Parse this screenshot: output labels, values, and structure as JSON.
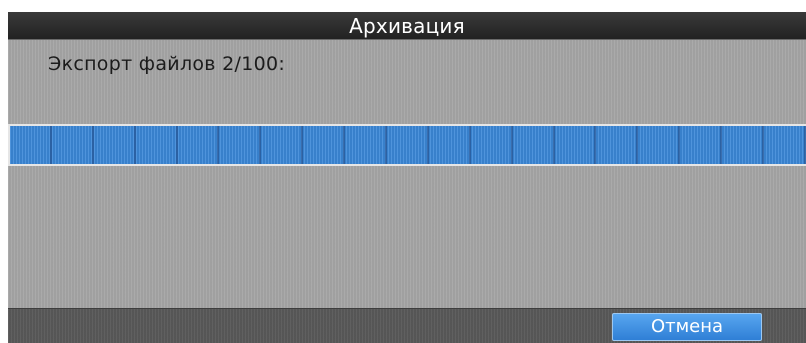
{
  "dialog": {
    "title": "Архивация",
    "status_text": "Экспорт файлов 2/100:",
    "progress": {
      "fraction": 1.0,
      "segments": 19,
      "fill_color": "#3b88d8"
    },
    "cancel_label": "Отмена",
    "accent_color": "#3f8ee0"
  }
}
